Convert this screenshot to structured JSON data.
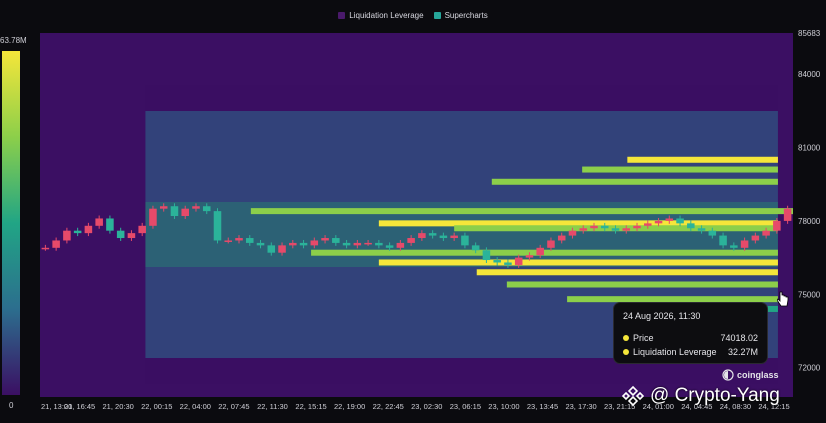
{
  "legend": [
    {
      "label": "Liquidation Leverage",
      "color": "#4a1a6b"
    },
    {
      "label": "Supercharts",
      "color": "#26a69a"
    }
  ],
  "colorbar": {
    "max_label": "63.78M",
    "min_label": "0"
  },
  "tooltip": {
    "date": "24 Aug 2026, 11:30",
    "price_label": "Price",
    "price_value": "74018.02",
    "price_color": "#f5e63a",
    "lev_label": "Liquidation Leverage",
    "lev_value": "32.27M",
    "lev_color": "#f5e63a"
  },
  "watermark": {
    "text": "coinglass"
  },
  "credit": {
    "text": "@ Crypto-Yang"
  },
  "chart_data": {
    "type": "heatmap",
    "x_ticks": [
      "21, 13:00",
      "21, 16:45",
      "21, 20:30",
      "22, 00:15",
      "22, 04:00",
      "22, 07:45",
      "22, 11:30",
      "22, 15:15",
      "22, 19:00",
      "22, 22:45",
      "23, 02:30",
      "23, 06:15",
      "23, 10:00",
      "23, 13:45",
      "23, 17:30",
      "23, 21:15",
      "24, 01:00",
      "24, 04:45",
      "24, 08:30",
      "24, 12:15"
    ],
    "y_ticks": [
      72000,
      75000,
      78000,
      81000,
      84000
    ],
    "y_top_label": "85683",
    "ylim": [
      70800,
      85683
    ],
    "colorbar_range": [
      0,
      63.78
    ],
    "colors": [
      "#3b0f63",
      "#2c6e8e",
      "#21a585",
      "#8ccf4a",
      "#f5e63a"
    ],
    "price": [
      76900,
      77200,
      77600,
      77500,
      77800,
      78100,
      77600,
      77300,
      77500,
      77800,
      78500,
      78600,
      78200,
      78500,
      78600,
      78400,
      77200,
      77200,
      77300,
      77100,
      77000,
      76700,
      77000,
      77100,
      77000,
      77200,
      77300,
      77100,
      77000,
      77100,
      77100,
      77000,
      76900,
      77100,
      77300,
      77500,
      77400,
      77300,
      77400,
      77000,
      76800,
      76400,
      76300,
      76200,
      76500,
      76600,
      76900,
      77200,
      77400,
      77600,
      77700,
      77800,
      77700,
      77600,
      77700,
      77800,
      77900,
      78000,
      78100,
      77900,
      77700,
      77600,
      77400,
      77000,
      76900,
      77200,
      77400,
      77600,
      78000,
      78500
    ],
    "bands": [
      {
        "price": 78400,
        "start": 0.28,
        "end": 1.0,
        "value": 40
      },
      {
        "price": 77900,
        "start": 0.45,
        "end": 0.98,
        "value": 60
      },
      {
        "price": 77700,
        "start": 0.55,
        "end": 0.98,
        "value": 55
      },
      {
        "price": 76700,
        "start": 0.36,
        "end": 0.98,
        "value": 45
      },
      {
        "price": 76300,
        "start": 0.45,
        "end": 0.98,
        "value": 58
      },
      {
        "price": 75900,
        "start": 0.58,
        "end": 0.98,
        "value": 62
      },
      {
        "price": 75400,
        "start": 0.62,
        "end": 0.98,
        "value": 52
      },
      {
        "price": 80500,
        "start": 0.78,
        "end": 0.98,
        "value": 58
      },
      {
        "price": 80100,
        "start": 0.72,
        "end": 0.98,
        "value": 48
      },
      {
        "price": 79600,
        "start": 0.6,
        "end": 0.98,
        "value": 40
      },
      {
        "price": 74800,
        "start": 0.7,
        "end": 0.98,
        "value": 50
      },
      {
        "price": 74400,
        "start": 0.8,
        "end": 0.98,
        "value": 38
      }
    ]
  }
}
